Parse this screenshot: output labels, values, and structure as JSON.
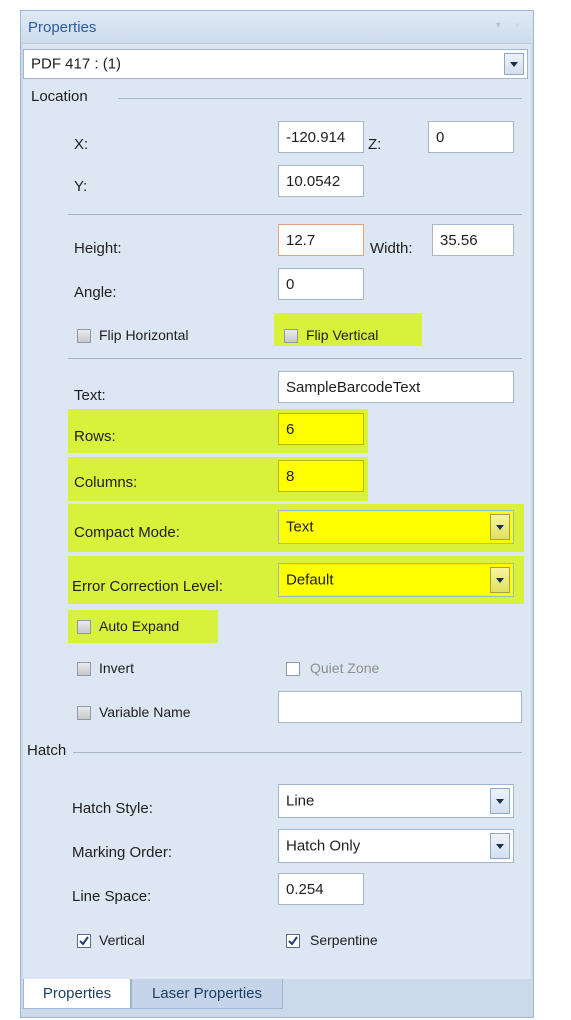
{
  "panel": {
    "title": "Properties"
  },
  "object_selector": {
    "value": "PDF 417 : (1)"
  },
  "location": {
    "header": "Location",
    "x_label": "X:",
    "x_value": "-120.914",
    "z_label": "Z:",
    "z_value": "0",
    "y_label": "Y:",
    "y_value": "10.0542"
  },
  "size": {
    "height_label": "Height:",
    "height_value": "12.7",
    "width_label": "Width:",
    "width_value": "35.56",
    "angle_label": "Angle:",
    "angle_value": "0",
    "flip_horizontal_label": "Flip Horizontal",
    "flip_vertical_label": "Flip Vertical"
  },
  "barcode": {
    "text_label": "Text:",
    "text_value": "SampleBarcodeText",
    "rows_label": "Rows:",
    "rows_value": "6",
    "columns_label": "Columns:",
    "columns_value": "8",
    "compact_mode_label": "Compact Mode:",
    "compact_mode_value": "Text",
    "error_correction_label": "Error Correction Level:",
    "error_correction_value": "Default",
    "auto_expand_label": "Auto Expand",
    "invert_label": "Invert",
    "quiet_zone_label": "Quiet Zone",
    "variable_name_label": "Variable Name",
    "variable_name_value": ""
  },
  "hatch": {
    "header": "Hatch",
    "style_label": "Hatch Style:",
    "style_value": "Line",
    "order_label": "Marking Order:",
    "order_value": "Hatch Only",
    "line_space_label": "Line Space:",
    "line_space_value": "0.254",
    "vertical_label": "Vertical",
    "serpentine_label": "Serpentine"
  },
  "tabs": {
    "properties": "Properties",
    "laser_properties": "Laser Properties"
  },
  "colors": {
    "highlight": "#d8f23b",
    "field_highlight": "#ffff00",
    "accent": "#2a5b9a"
  }
}
